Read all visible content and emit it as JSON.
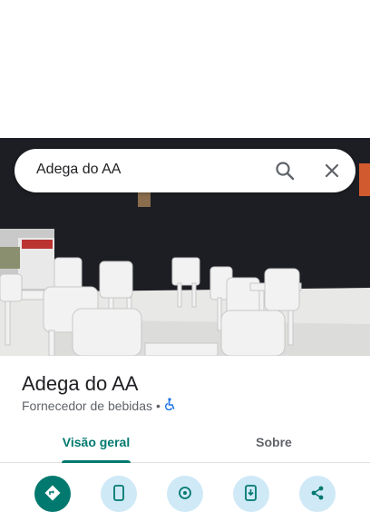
{
  "search": {
    "query": "Adega do AA"
  },
  "place": {
    "name": "Adega do AA",
    "category": "Fornecedor de bebidas",
    "separator": "•"
  },
  "tabs": [
    {
      "label": "Visão geral",
      "active": true
    },
    {
      "label": "Sobre",
      "active": false
    }
  ],
  "actions": [
    "directions-icon",
    "phone-icon",
    "save-icon",
    "send-to-phone-icon",
    "share-icon"
  ],
  "colors": {
    "accent": "#01796f",
    "action_bg": "#cfe9f7",
    "wheelchair": "#1a73e8"
  }
}
